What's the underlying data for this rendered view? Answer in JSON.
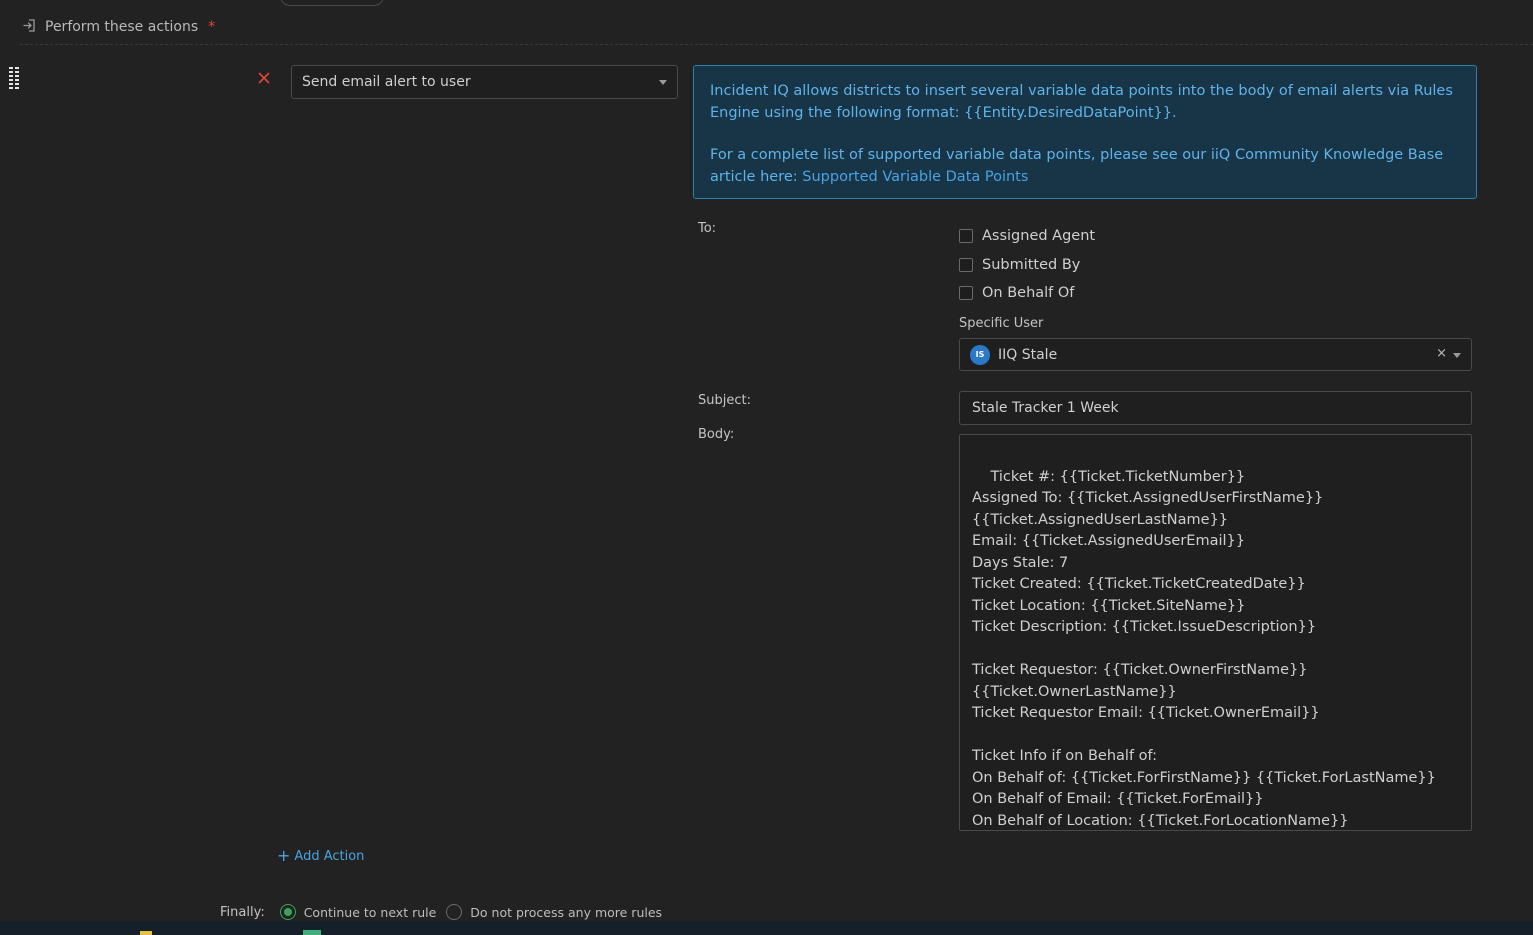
{
  "section": {
    "title": "Perform these actions",
    "required_mark": "*"
  },
  "action": {
    "selected": "Send email alert to user"
  },
  "info": {
    "line1": "Incident IQ allows districts to insert several variable data points into the body of email alerts via Rules Engine using the following format: {{Entity.DesiredDataPoint}}.",
    "line2_prefix": "For a complete list of supported variable data points, please see our iiQ Community Knowledge Base article here: ",
    "link_text": "Supported Variable Data Points"
  },
  "to": {
    "label": "To:",
    "options": [
      {
        "label": "Assigned Agent",
        "checked": false
      },
      {
        "label": "Submitted By",
        "checked": false
      },
      {
        "label": "On Behalf Of",
        "checked": false
      }
    ],
    "specific_user_label": "Specific User",
    "specific_user": {
      "initials": "IS",
      "name": "IIQ Stale",
      "clear_glyph": "×"
    }
  },
  "subject": {
    "label": "Subject:",
    "value": "Stale Tracker 1 Week"
  },
  "body": {
    "label": "Body:",
    "value": "Ticket #: {{Ticket.TicketNumber}}\nAssigned To: {{Ticket.AssignedUserFirstName}}\n{{Ticket.AssignedUserLastName}}\nEmail: {{Ticket.AssignedUserEmail}}\nDays Stale: 7\nTicket Created: {{Ticket.TicketCreatedDate}}\nTicket Location: {{Ticket.SiteName}}\nTicket Description: {{Ticket.IssueDescription}}\n\nTicket Requestor: {{Ticket.OwnerFirstName}}\n{{Ticket.OwnerLastName}}\nTicket Requestor Email: {{Ticket.OwnerEmail}}\n\nTicket Info if on Behalf of:\nOn Behalf of: {{Ticket.ForFirstName}} {{Ticket.ForLastName}}\nOn Behalf of Email: {{Ticket.ForEmail}}\nOn Behalf of Location: {{Ticket.ForLocationName}}"
  },
  "add_action": {
    "plus": "+",
    "label": "Add Action"
  },
  "finally": {
    "label": "Finally:",
    "options": [
      {
        "label": "Continue to next rule",
        "selected": true
      },
      {
        "label": "Do not process any more rules",
        "selected": false
      }
    ]
  },
  "colors": {
    "background": "#222222",
    "info_bg": "#183447",
    "info_border": "#2f7fb2",
    "link": "#4aa3e0",
    "danger": "#e0463c",
    "radio_on": "#3aa55a"
  }
}
